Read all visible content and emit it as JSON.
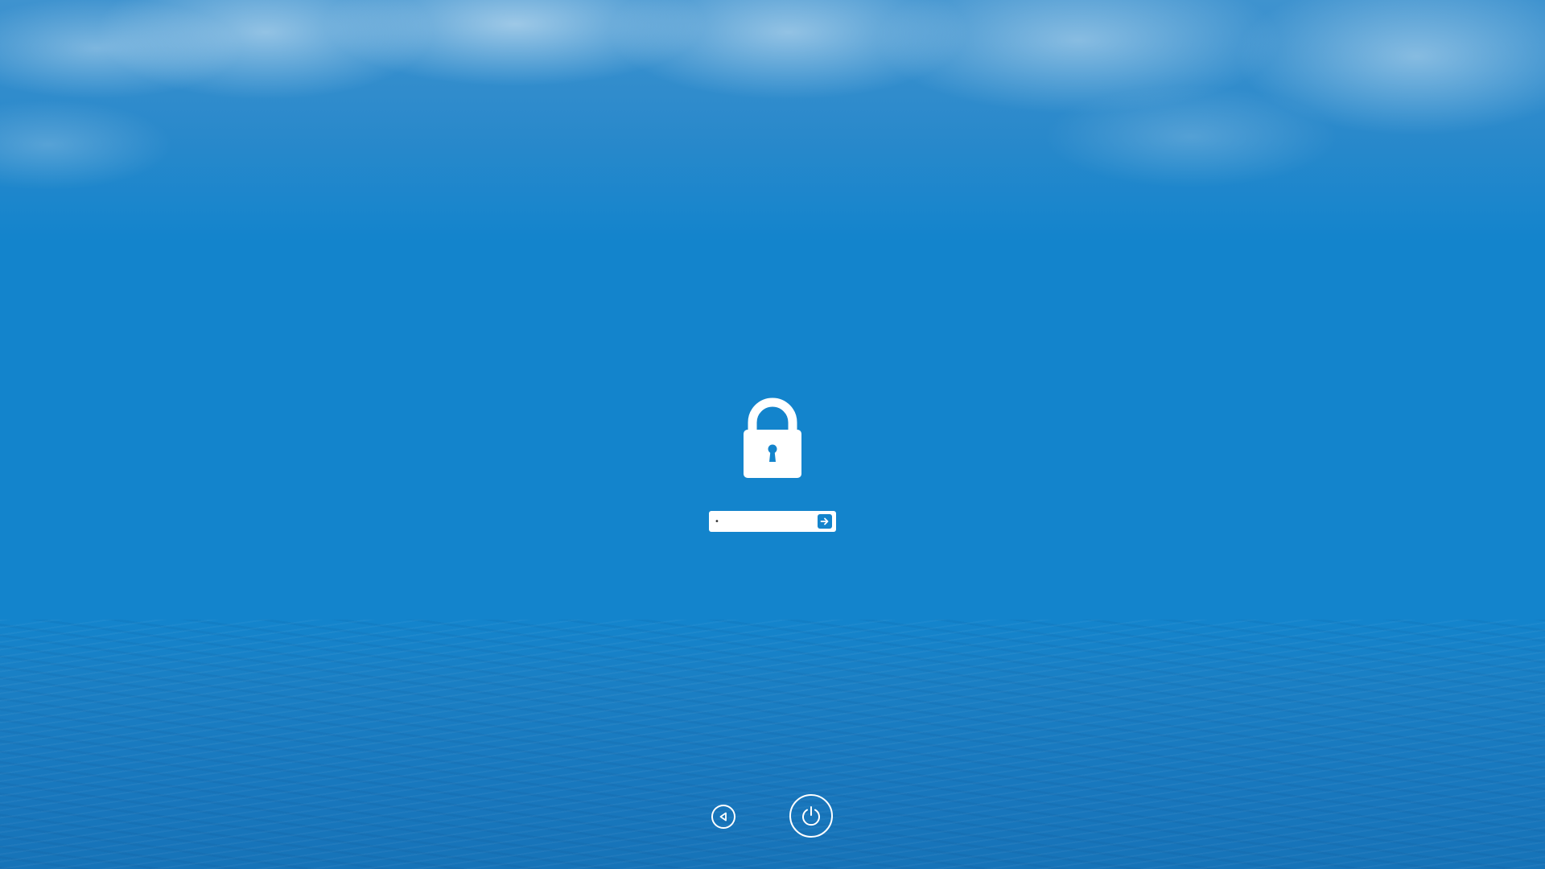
{
  "screen": {
    "type": "lock-screen",
    "background": "sky-over-sea"
  },
  "lock": {
    "icon": "padlock-icon"
  },
  "password": {
    "value": "•",
    "masked": true,
    "submit_icon": "arrow-right-icon"
  },
  "controls": {
    "back_icon": "triangle-left-icon",
    "power_icon": "power-icon"
  },
  "colors": {
    "background": "#1384cc",
    "foreground": "#ffffff",
    "accent": "#1384cc"
  }
}
